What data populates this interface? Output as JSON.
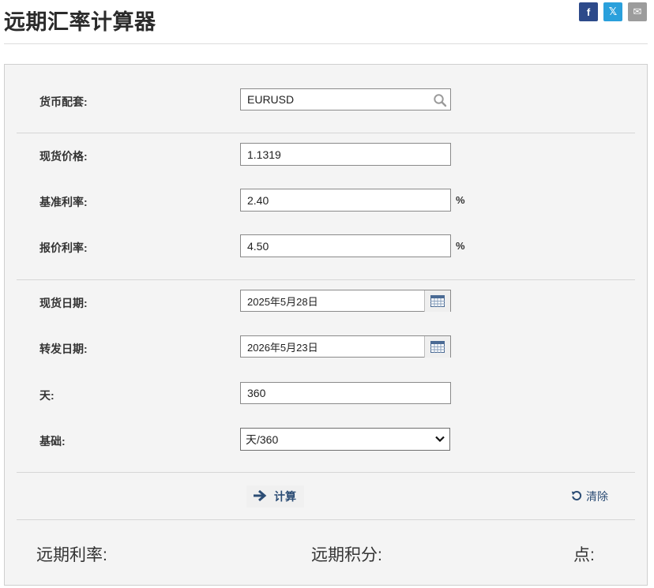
{
  "page": {
    "title": "远期汇率计算器"
  },
  "share": {
    "facebook": "f",
    "twitter": "𝕏",
    "email": "✉"
  },
  "form": {
    "currency_pair": {
      "label": "货币配套:",
      "value": "EURUSD"
    },
    "spot_price": {
      "label": "现货价格:",
      "value": "1.1319"
    },
    "base_rate": {
      "label": "基准利率:",
      "value": "2.40",
      "unit": "%"
    },
    "quote_rate": {
      "label": "报价利率:",
      "value": "4.50",
      "unit": "%"
    },
    "spot_date": {
      "label": "现货日期:",
      "value": "2025年5月28日"
    },
    "forward_date": {
      "label": "转发日期:",
      "value": "2026年5月23日"
    },
    "days": {
      "label": "天:",
      "value": "360"
    },
    "basis": {
      "label": "基础:",
      "selected": "天/360"
    }
  },
  "actions": {
    "calculate": "计算",
    "clear": "清除"
  },
  "results": {
    "forward_rate": "远期利率:",
    "forward_points": "远期积分:",
    "points": "点:"
  },
  "colors": {
    "accent": "#2c4d75",
    "facebook": "#2d4a8a",
    "twitter": "#2aa0dc",
    "email": "#9c9c9c",
    "panel": "#f4f4f4"
  }
}
